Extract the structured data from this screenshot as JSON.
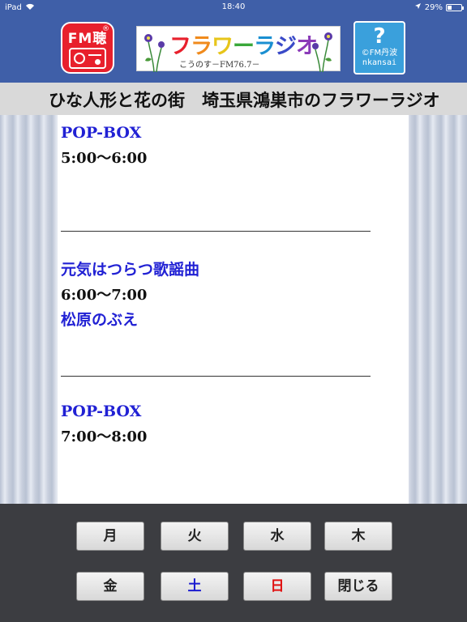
{
  "status_bar": {
    "device": "iPad",
    "time": "18:40",
    "battery_text": "29%",
    "battery_level": 0.29
  },
  "header": {
    "fm_logo_text": "FM聴",
    "fm_logo_mark": "®",
    "station_name": "フラワーラジオ",
    "station_name_colors": [
      "#e8202c",
      "#f08a1c",
      "#e7c51a",
      "#3aa83a",
      "#1a8fd1",
      "#3a4ac8",
      "#8a3ab8"
    ],
    "station_sub": "こうのす－FM76.7－",
    "help_symbol": "?",
    "help_copyright": "©FM丹波",
    "help_sub": "nkansai"
  },
  "marquee": {
    "text": "ひな人形と花の街　埼玉県鴻巣市のフラワーラジオ"
  },
  "programs": [
    {
      "title": "POP-BOX",
      "time": "5:00〜6:00",
      "host": ""
    },
    {
      "title": "元気はつらつ歌謡曲",
      "time": "6:00〜7:00",
      "host": "松原のぶえ"
    },
    {
      "title": "POP-BOX",
      "time": "7:00〜8:00",
      "host": ""
    }
  ],
  "days": {
    "mon": "月",
    "tue": "火",
    "wed": "水",
    "thu": "木",
    "fri": "金",
    "sat": "土",
    "sun": "日",
    "close": "閉じる"
  },
  "colors": {
    "header_bg": "#3f5fa8",
    "title_blue": "#2121d4",
    "saturday": "#1a1ad0",
    "sunday": "#e01010",
    "toolbar_bg": "#3c3d41"
  }
}
